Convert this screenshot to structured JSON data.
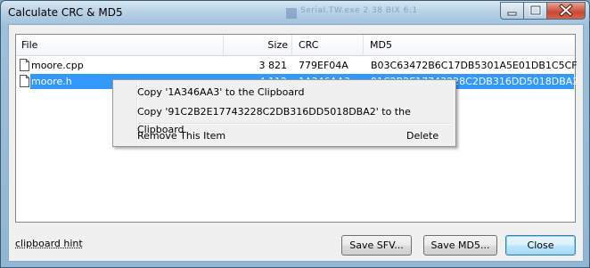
{
  "window": {
    "title": "Calculate CRC & MD5",
    "background_hint": "Serial.TW.exe   2 38 BIX   6:1",
    "controls": [
      "minimize-icon",
      "maximize-icon",
      "close-icon"
    ]
  },
  "list": {
    "columns": [
      {
        "label": "File"
      },
      {
        "label": "Size"
      },
      {
        "label": "CRC"
      },
      {
        "label": "MD5"
      }
    ],
    "rows": [
      {
        "file": "moore.cpp",
        "size": "3 821",
        "crc": "779EF04A",
        "md5": "B03C63472B6C17DB5301A5E01DB1C5CF",
        "selected": false
      },
      {
        "file": "moore.h",
        "size": "4 112",
        "crc": "1A346AA3",
        "md5": "91C2B2E17743228C2DB316DD5018DBA2",
        "selected": true
      }
    ]
  },
  "context_menu": {
    "copy_crc": "Copy '1A346AA3' to the Clipboard",
    "copy_md5": "Copy '91C2B2E17743228C2DB316DD5018DBA2' to the Clipboard",
    "remove": "Remove This Item",
    "remove_key": "Delete"
  },
  "footer": {
    "hint": "clipboard hint",
    "save_sfv": "Save SFV...",
    "save_md5": "Save MD5...",
    "close": "Close"
  },
  "colors": {
    "selection": "#3399ff",
    "title_bar": "#b9d2e6",
    "close_button": "#c74a33"
  }
}
